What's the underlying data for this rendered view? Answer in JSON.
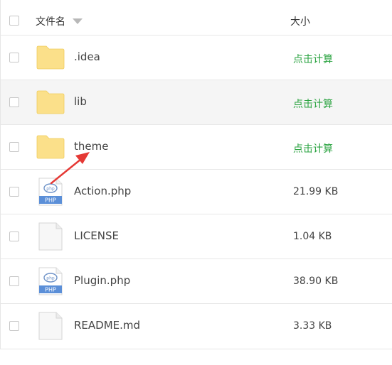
{
  "header": {
    "name_label": "文件名",
    "size_label": "大小",
    "sort_icon": "sort-down-triangle-icon"
  },
  "colors": {
    "calc_link": "#2aa340",
    "folder": "#fbe08a",
    "php_badge": "#5b8fd8",
    "arrow": "#e53935"
  },
  "files": [
    {
      "name": ".idea",
      "size": "点击计算",
      "type": "folder-icon"
    },
    {
      "name": "lib",
      "size": "点击计算",
      "type": "folder-icon"
    },
    {
      "name": "theme",
      "size": "点击计算",
      "type": "folder-icon"
    },
    {
      "name": "Action.php",
      "size": "21.99 KB",
      "type": "php-file-icon",
      "badge": "PHP",
      "logo": "php"
    },
    {
      "name": "LICENSE",
      "size": "1.04 KB",
      "type": "blank-file-icon"
    },
    {
      "name": "Plugin.php",
      "size": "38.90 KB",
      "type": "php-file-icon",
      "badge": "PHP",
      "logo": "php"
    },
    {
      "name": "README.md",
      "size": "3.33 KB",
      "type": "blank-file-icon"
    }
  ]
}
